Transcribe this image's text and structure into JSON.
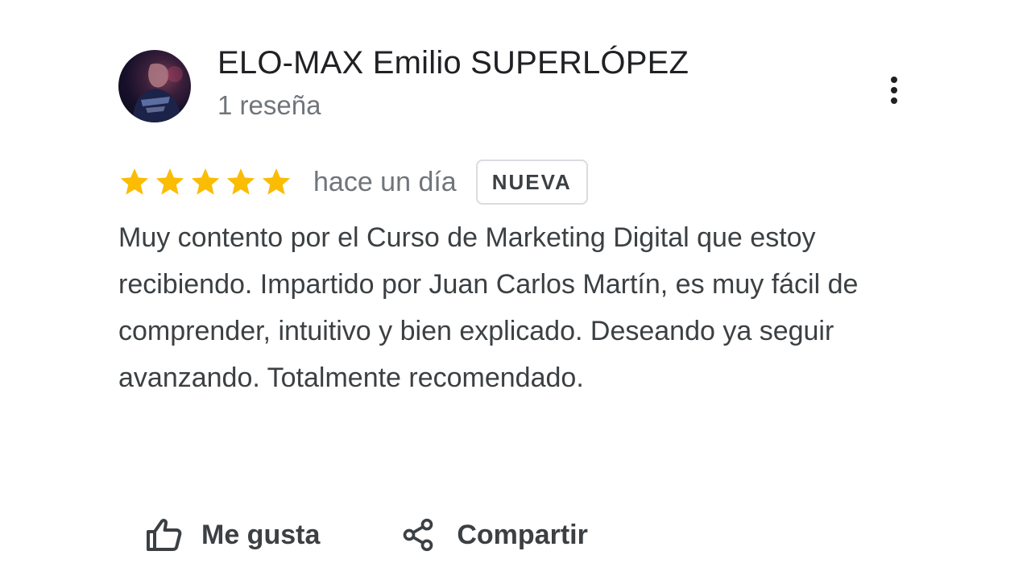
{
  "review": {
    "author": {
      "name": "ELO-MAX Emilio SUPERLÓPEZ",
      "review_count": "1 reseña",
      "avatar_icon": "user-photo-avatar"
    },
    "menu_icon": "more-vert-icon",
    "rating": {
      "stars": 5,
      "max_stars": 5,
      "star_color": "#fbbc04"
    },
    "date": "hace un día",
    "badge": "NUEVA",
    "text": "Muy contento por el Curso de Marketing Digital que estoy recibiendo. Impartido por Juan Carlos Martín, es muy fácil de comprender, intuitivo y bien explicado. Deseando ya seguir avanzando. Totalmente recomendado."
  },
  "actions": {
    "like_label": "Me gusta",
    "like_icon": "thumb-up-icon",
    "share_label": "Compartir",
    "share_icon": "share-icon"
  }
}
